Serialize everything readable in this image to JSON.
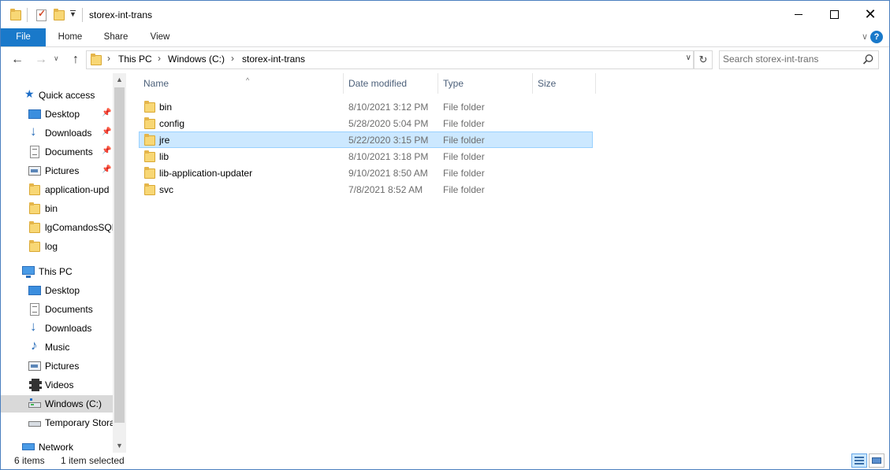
{
  "window": {
    "title": "storex-int-trans"
  },
  "ribbon": {
    "tabs": [
      {
        "label": "File"
      },
      {
        "label": "Home"
      },
      {
        "label": "Share"
      },
      {
        "label": "View"
      }
    ],
    "help_label": "?"
  },
  "address": {
    "crumbs": [
      {
        "label": "This PC"
      },
      {
        "label": "Windows (C:)"
      },
      {
        "label": "storex-int-trans"
      }
    ]
  },
  "search": {
    "placeholder": "Search storex-int-trans"
  },
  "nav_pane": {
    "quick_access": {
      "label": "Quick access",
      "icon": "star-icon",
      "items": [
        {
          "label": "Desktop",
          "icon": "desktop-icon",
          "pinned": true
        },
        {
          "label": "Downloads",
          "icon": "downloads-icon",
          "pinned": true
        },
        {
          "label": "Documents",
          "icon": "documents-icon",
          "pinned": true
        },
        {
          "label": "Pictures",
          "icon": "pictures-icon",
          "pinned": true
        },
        {
          "label": "application-upd",
          "icon": "folder-icon",
          "pinned": false
        },
        {
          "label": "bin",
          "icon": "folder-icon",
          "pinned": false
        },
        {
          "label": "lgComandosSQL",
          "icon": "folder-icon",
          "pinned": false
        },
        {
          "label": "log",
          "icon": "folder-icon",
          "pinned": false
        }
      ]
    },
    "this_pc": {
      "label": "This PC",
      "icon": "computer-icon",
      "items": [
        {
          "label": "Desktop",
          "icon": "desktop-icon"
        },
        {
          "label": "Documents",
          "icon": "documents-icon"
        },
        {
          "label": "Downloads",
          "icon": "downloads-icon"
        },
        {
          "label": "Music",
          "icon": "music-icon"
        },
        {
          "label": "Pictures",
          "icon": "pictures-icon"
        },
        {
          "label": "Videos",
          "icon": "videos-icon"
        },
        {
          "label": "Windows (C:)",
          "icon": "drive-icon",
          "selected": true
        },
        {
          "label": "Temporary Stora",
          "icon": "network-drive-icon"
        }
      ]
    },
    "network": {
      "label": "Network",
      "icon": "network-icon"
    }
  },
  "columns": [
    {
      "label": "Name"
    },
    {
      "label": "Date modified"
    },
    {
      "label": "Type"
    },
    {
      "label": "Size"
    }
  ],
  "files": [
    {
      "name": "bin",
      "date": "8/10/2021 3:12 PM",
      "type": "File folder",
      "selected": false
    },
    {
      "name": "config",
      "date": "5/28/2020 5:04 PM",
      "type": "File folder",
      "selected": false
    },
    {
      "name": "jre",
      "date": "5/22/2020 3:15 PM",
      "type": "File folder",
      "selected": true
    },
    {
      "name": "lib",
      "date": "8/10/2021 3:18 PM",
      "type": "File folder",
      "selected": false
    },
    {
      "name": "lib-application-updater",
      "date": "9/10/2021 8:50 AM",
      "type": "File folder",
      "selected": false
    },
    {
      "name": "svc",
      "date": "7/8/2021 8:52 AM",
      "type": "File folder",
      "selected": false
    }
  ],
  "status": {
    "item_count": "6 items",
    "selection": "1 item selected"
  },
  "colors": {
    "accent": "#1979ca",
    "selection_bg": "#cce8ff",
    "folder": "#f8d775"
  }
}
